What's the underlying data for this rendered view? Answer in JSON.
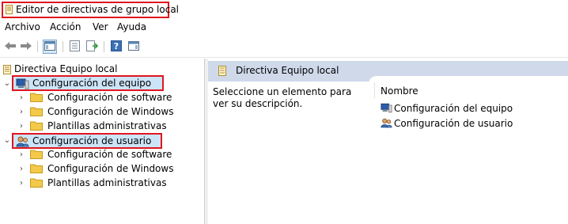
{
  "window": {
    "title": "Editor de directivas de grupo local",
    "highlight_color": "#e0161e"
  },
  "menubar": {
    "items": [
      "Archivo",
      "Acción",
      "Ver",
      "Ayuda"
    ]
  },
  "toolbar": {
    "buttons": [
      {
        "name": "back-button",
        "icon": "arrow-left-icon"
      },
      {
        "name": "forward-button",
        "icon": "arrow-right-icon"
      },
      {
        "name": "show-hide-tree-button",
        "icon": "console-tree-icon"
      },
      {
        "name": "properties-button",
        "icon": "properties-icon"
      },
      {
        "name": "export-list-button",
        "icon": "export-list-icon"
      },
      {
        "name": "help-button",
        "icon": "help-icon"
      },
      {
        "name": "show-hide-action-pane-button",
        "icon": "action-pane-icon"
      }
    ]
  },
  "tree": {
    "root": {
      "label": "Directiva Equipo local",
      "icon": "policy-document-icon"
    },
    "nodes": [
      {
        "label": "Configuración del equipo",
        "icon": "computer-icon",
        "expanded": true,
        "highlighted": true,
        "children": [
          {
            "label": "Configuración de software",
            "icon": "folder-icon"
          },
          {
            "label": "Configuración de Windows",
            "icon": "folder-icon"
          },
          {
            "label": "Plantillas administrativas",
            "icon": "folder-icon"
          }
        ]
      },
      {
        "label": "Configuración de usuario",
        "icon": "users-icon",
        "expanded": true,
        "highlighted": true,
        "children": [
          {
            "label": "Configuración de software",
            "icon": "folder-icon"
          },
          {
            "label": "Configuración de Windows",
            "icon": "folder-icon"
          },
          {
            "label": "Plantillas administrativas",
            "icon": "folder-icon"
          }
        ]
      }
    ]
  },
  "details": {
    "header": "Directiva Equipo local",
    "description": "Seleccione un elemento para ver su descripción.",
    "column_header": "Nombre",
    "items": [
      {
        "label": "Configuración del equipo",
        "icon": "computer-icon"
      },
      {
        "label": "Configuración de usuario",
        "icon": "users-icon"
      }
    ]
  }
}
